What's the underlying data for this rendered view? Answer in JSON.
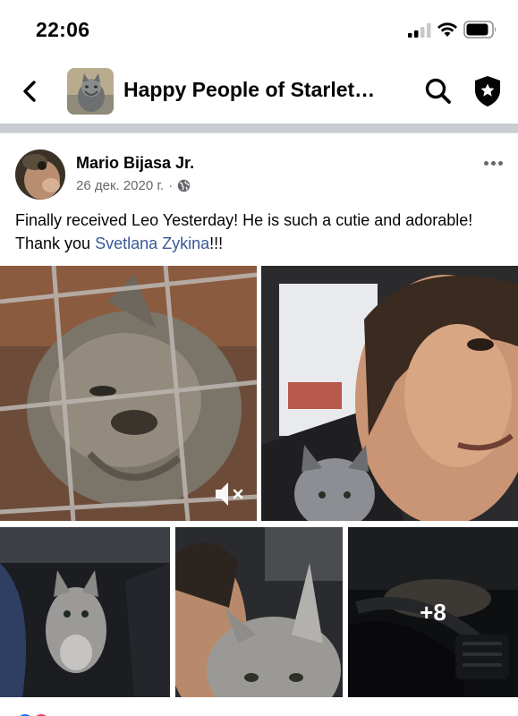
{
  "status_bar": {
    "time": "22:06"
  },
  "nav": {
    "group_name": "Happy People of Starlet…"
  },
  "post": {
    "author": "Mario Bijasa Jr.",
    "date": "26 дек. 2020 г.",
    "separator": "·",
    "text_before": "Finally received Leo Yesterday! He is such a cutie and adorable! Thank you ",
    "mention": "Svetlana  Zykina",
    "text_after": "!!!",
    "extra_photos": "+8"
  },
  "colors": {
    "mention": "#385898",
    "secondary_text": "#65676b",
    "separator": "#c9ccd1"
  }
}
